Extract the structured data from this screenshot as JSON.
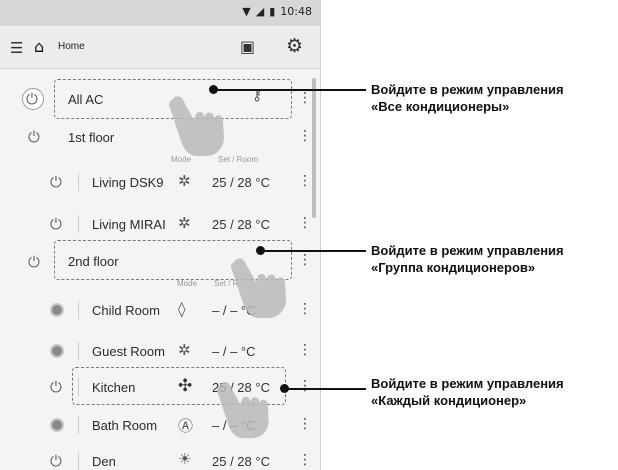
{
  "status_bar": {
    "time": "10:48"
  },
  "toolbar": {
    "title": "Home"
  },
  "column_headers": {
    "mode": "Mode",
    "set_room": "Set / Room",
    "set_room_short": "Set / R"
  },
  "rows": [
    {
      "name": "All AC"
    },
    {
      "name": "1st floor"
    },
    {
      "name": "Living DSK9",
      "temp": "25 / 28 °C"
    },
    {
      "name": "Living MIRAI",
      "temp": "25 / 28 °C"
    },
    {
      "name": "2nd floor"
    },
    {
      "name": "Child Room",
      "temp": "– / –  °C"
    },
    {
      "name": "Guest Room",
      "temp": "– / –  °C"
    },
    {
      "name": "Kitchen",
      "temp": "25 / 28 °C"
    },
    {
      "name": "Bath Room",
      "temp": "– / –  °C"
    },
    {
      "name": "Den",
      "temp": "25 / 28 °C"
    }
  ],
  "callouts": [
    {
      "line1": "Войдите в режим управления",
      "line2": "«Все кондиционеры»"
    },
    {
      "line1": "Войдите в режим управления",
      "line2": "«Группа кондиционеров»"
    },
    {
      "line1": "Войдите в режим управления",
      "line2": "«Каждый кондиционер»"
    }
  ],
  "icons": {
    "menu": "menu-icon",
    "home": "home-icon",
    "schedule": "schedule-icon",
    "settings": "gear-icon",
    "power": "power-icon",
    "more": "more-vertical-icon",
    "heat": "heat-mode-icon",
    "dry": "dry-mode-icon",
    "fan": "fan-mode-icon",
    "auto": "auto-mode-icon",
    "cool": "cool-mode-icon"
  }
}
